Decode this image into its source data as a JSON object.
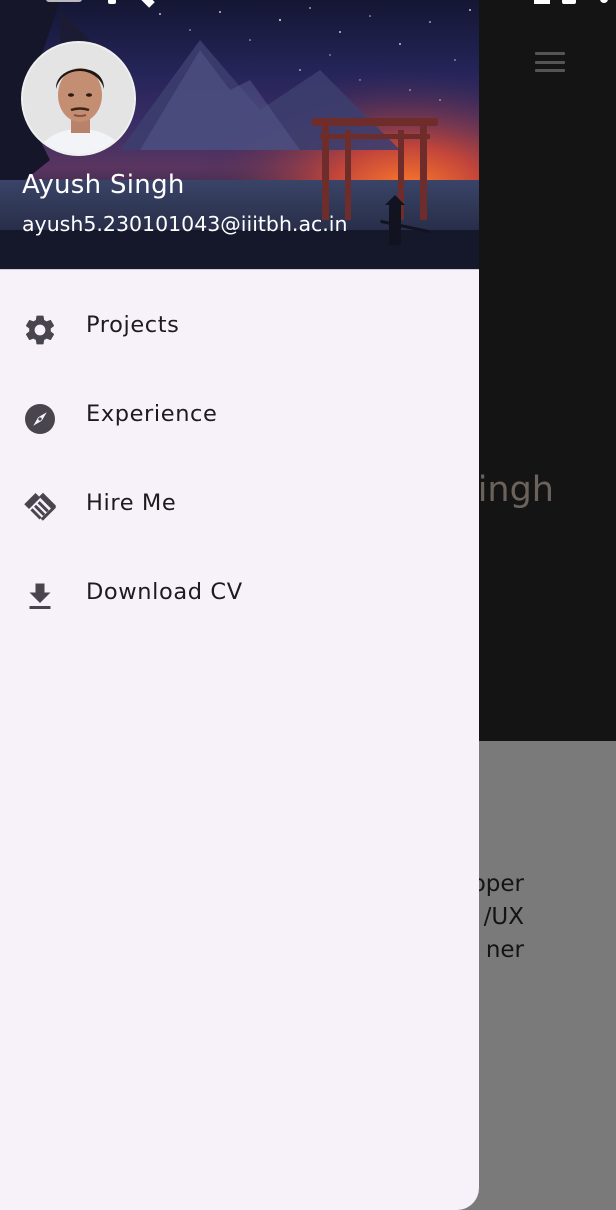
{
  "background_app": {
    "name_fragment": "ingh",
    "role_lines": [
      "oper",
      "/UX",
      "ner"
    ]
  },
  "drawer": {
    "header": {
      "user_name": "Ayush Singh",
      "user_email": "ayush5.230101043@iiitbh.ac.in"
    },
    "items": [
      {
        "label": "Projects",
        "icon": "gear-icon"
      },
      {
        "label": "Experience",
        "icon": "compass-icon"
      },
      {
        "label": "Hire Me",
        "icon": "handshake-icon"
      },
      {
        "label": "Download CV",
        "icon": "download-icon"
      }
    ]
  },
  "colors": {
    "drawer_bg": "#f7f2f9",
    "icon": "#49454f",
    "scrim_top": "#141414",
    "scrim_bottom": "#7a7a7a"
  }
}
